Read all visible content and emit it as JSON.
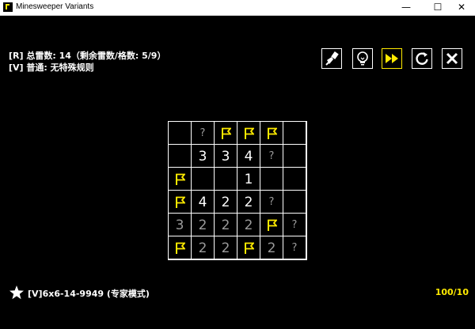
{
  "window": {
    "title": "Minesweeper Variants",
    "minimize": "—",
    "maximize": "☐",
    "close": "✕"
  },
  "info": {
    "line1": "[R] 总雷数: 14（剩余雷数/格数: 5/9）",
    "line2": "[V] 普通: 无特殊规则"
  },
  "toolbar": [
    {
      "name": "brush-tool-button",
      "icon": "brush-icon",
      "active": false
    },
    {
      "name": "hint-button",
      "icon": "lightbulb-icon",
      "active": false
    },
    {
      "name": "auto-solve-button",
      "icon": "fast-forward-icon",
      "active": true
    },
    {
      "name": "restart-button",
      "icon": "refresh-icon",
      "active": false
    },
    {
      "name": "close-game-button",
      "icon": "close-icon",
      "active": false
    }
  ],
  "board": {
    "rows": 6,
    "cols": 6,
    "cells": [
      [
        {
          "t": "empty"
        },
        {
          "t": "q",
          "v": "?"
        },
        {
          "t": "flag"
        },
        {
          "t": "flag"
        },
        {
          "t": "flag"
        },
        {
          "t": "empty"
        }
      ],
      [
        {
          "t": "empty"
        },
        {
          "t": "num",
          "v": "3"
        },
        {
          "t": "num",
          "v": "3"
        },
        {
          "t": "num",
          "v": "4"
        },
        {
          "t": "q",
          "v": "?"
        },
        {
          "t": "empty"
        }
      ],
      [
        {
          "t": "flag"
        },
        {
          "t": "empty"
        },
        {
          "t": "empty"
        },
        {
          "t": "num",
          "v": "1"
        },
        {
          "t": "empty"
        },
        {
          "t": "empty"
        }
      ],
      [
        {
          "t": "flag"
        },
        {
          "t": "num",
          "v": "4"
        },
        {
          "t": "num",
          "v": "2"
        },
        {
          "t": "num",
          "v": "2"
        },
        {
          "t": "q",
          "v": "?"
        },
        {
          "t": "empty"
        }
      ],
      [
        {
          "t": "dim",
          "v": "3"
        },
        {
          "t": "dim",
          "v": "2"
        },
        {
          "t": "dim",
          "v": "2"
        },
        {
          "t": "dim",
          "v": "2"
        },
        {
          "t": "flag"
        },
        {
          "t": "q",
          "v": "?"
        }
      ],
      [
        {
          "t": "flag"
        },
        {
          "t": "dim",
          "v": "2"
        },
        {
          "t": "dim",
          "v": "2"
        },
        {
          "t": "flag"
        },
        {
          "t": "dim",
          "v": "2"
        },
        {
          "t": "q",
          "v": "?"
        }
      ]
    ]
  },
  "footer": {
    "puzzle_id": "[V]6x6-14-9949 (专家模式)",
    "progress": "100/10"
  },
  "colors": {
    "flag": "#ffea00",
    "progress": "#ffea00",
    "dim_number": "#9a9a9a"
  }
}
